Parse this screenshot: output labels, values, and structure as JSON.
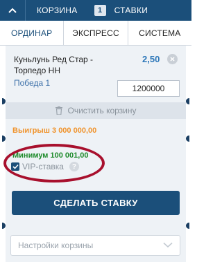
{
  "header": {
    "cart_label": "КОРЗИНА",
    "cart_count": "1",
    "bets_label": "СТАВКИ"
  },
  "tabs": [
    {
      "label": "ОРДИНАР",
      "active": true
    },
    {
      "label": "ЭКСПРЕСС",
      "active": false
    },
    {
      "label": "СИСТЕМА",
      "active": false
    }
  ],
  "bet": {
    "event": "Куньлунь Ред Стар - Торпедо НН",
    "odds": "2,50",
    "outcome": "Победа 1",
    "stake": "1200000"
  },
  "clear_label": "Очистить корзину",
  "winnings": "Выигрыш 3 000 000,00",
  "minimum": "Минимум 100 001,00",
  "vip": {
    "label": "VIP-ставка",
    "help": "?",
    "checked": true
  },
  "submit_label": "СДЕЛАТЬ СТАВКУ",
  "settings_placeholder": "Настройки корзины",
  "colors": {
    "primary": "#1b4f7a",
    "odds": "#2e78b9",
    "winnings": "#f0932b",
    "minimum": "#1d8a2a",
    "annotation": "#a8102d"
  }
}
